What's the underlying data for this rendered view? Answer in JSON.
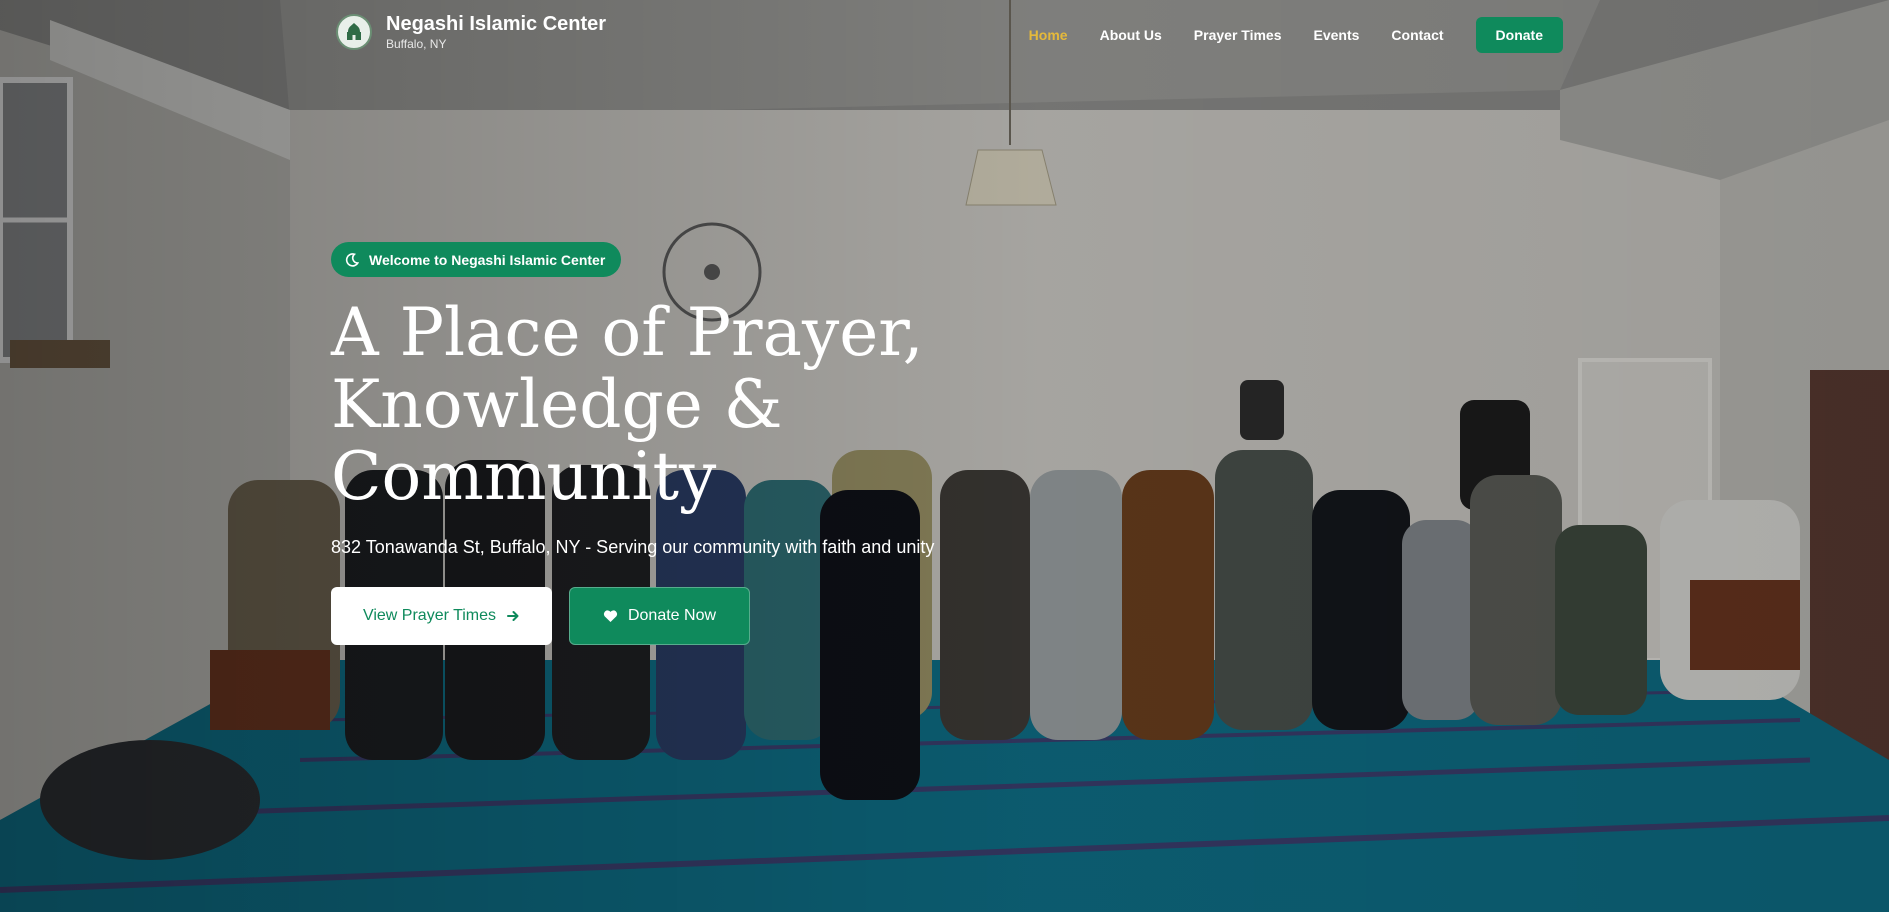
{
  "header": {
    "brand_name": "Negashi Islamic Center",
    "brand_location": "Buffalo, NY",
    "nav": [
      {
        "label": "Home",
        "active": true
      },
      {
        "label": "About Us",
        "active": false
      },
      {
        "label": "Prayer Times",
        "active": false
      },
      {
        "label": "Events",
        "active": false
      },
      {
        "label": "Contact",
        "active": false
      }
    ],
    "donate_label": "Donate"
  },
  "hero": {
    "badge": "Welcome to Negashi Islamic Center",
    "headline_lines": [
      "A Place of Prayer,",
      "Knowledge &",
      "Community"
    ],
    "subtitle": "832 Tonawanda St, Buffalo, NY - Serving our community with faith and unity",
    "primary_button": "View Prayer Times",
    "secondary_button": "Donate Now"
  },
  "icons": {
    "badge": "moon-icon",
    "primary_button": "arrow-right-icon",
    "secondary_button": "heart-icon",
    "logo": "mosque-logo-icon"
  },
  "colors": {
    "accent_green": "#0f8a5c",
    "active_nav": "#e5b93a",
    "carpet": "#0e6e86",
    "wall": "#c9c7c2"
  }
}
